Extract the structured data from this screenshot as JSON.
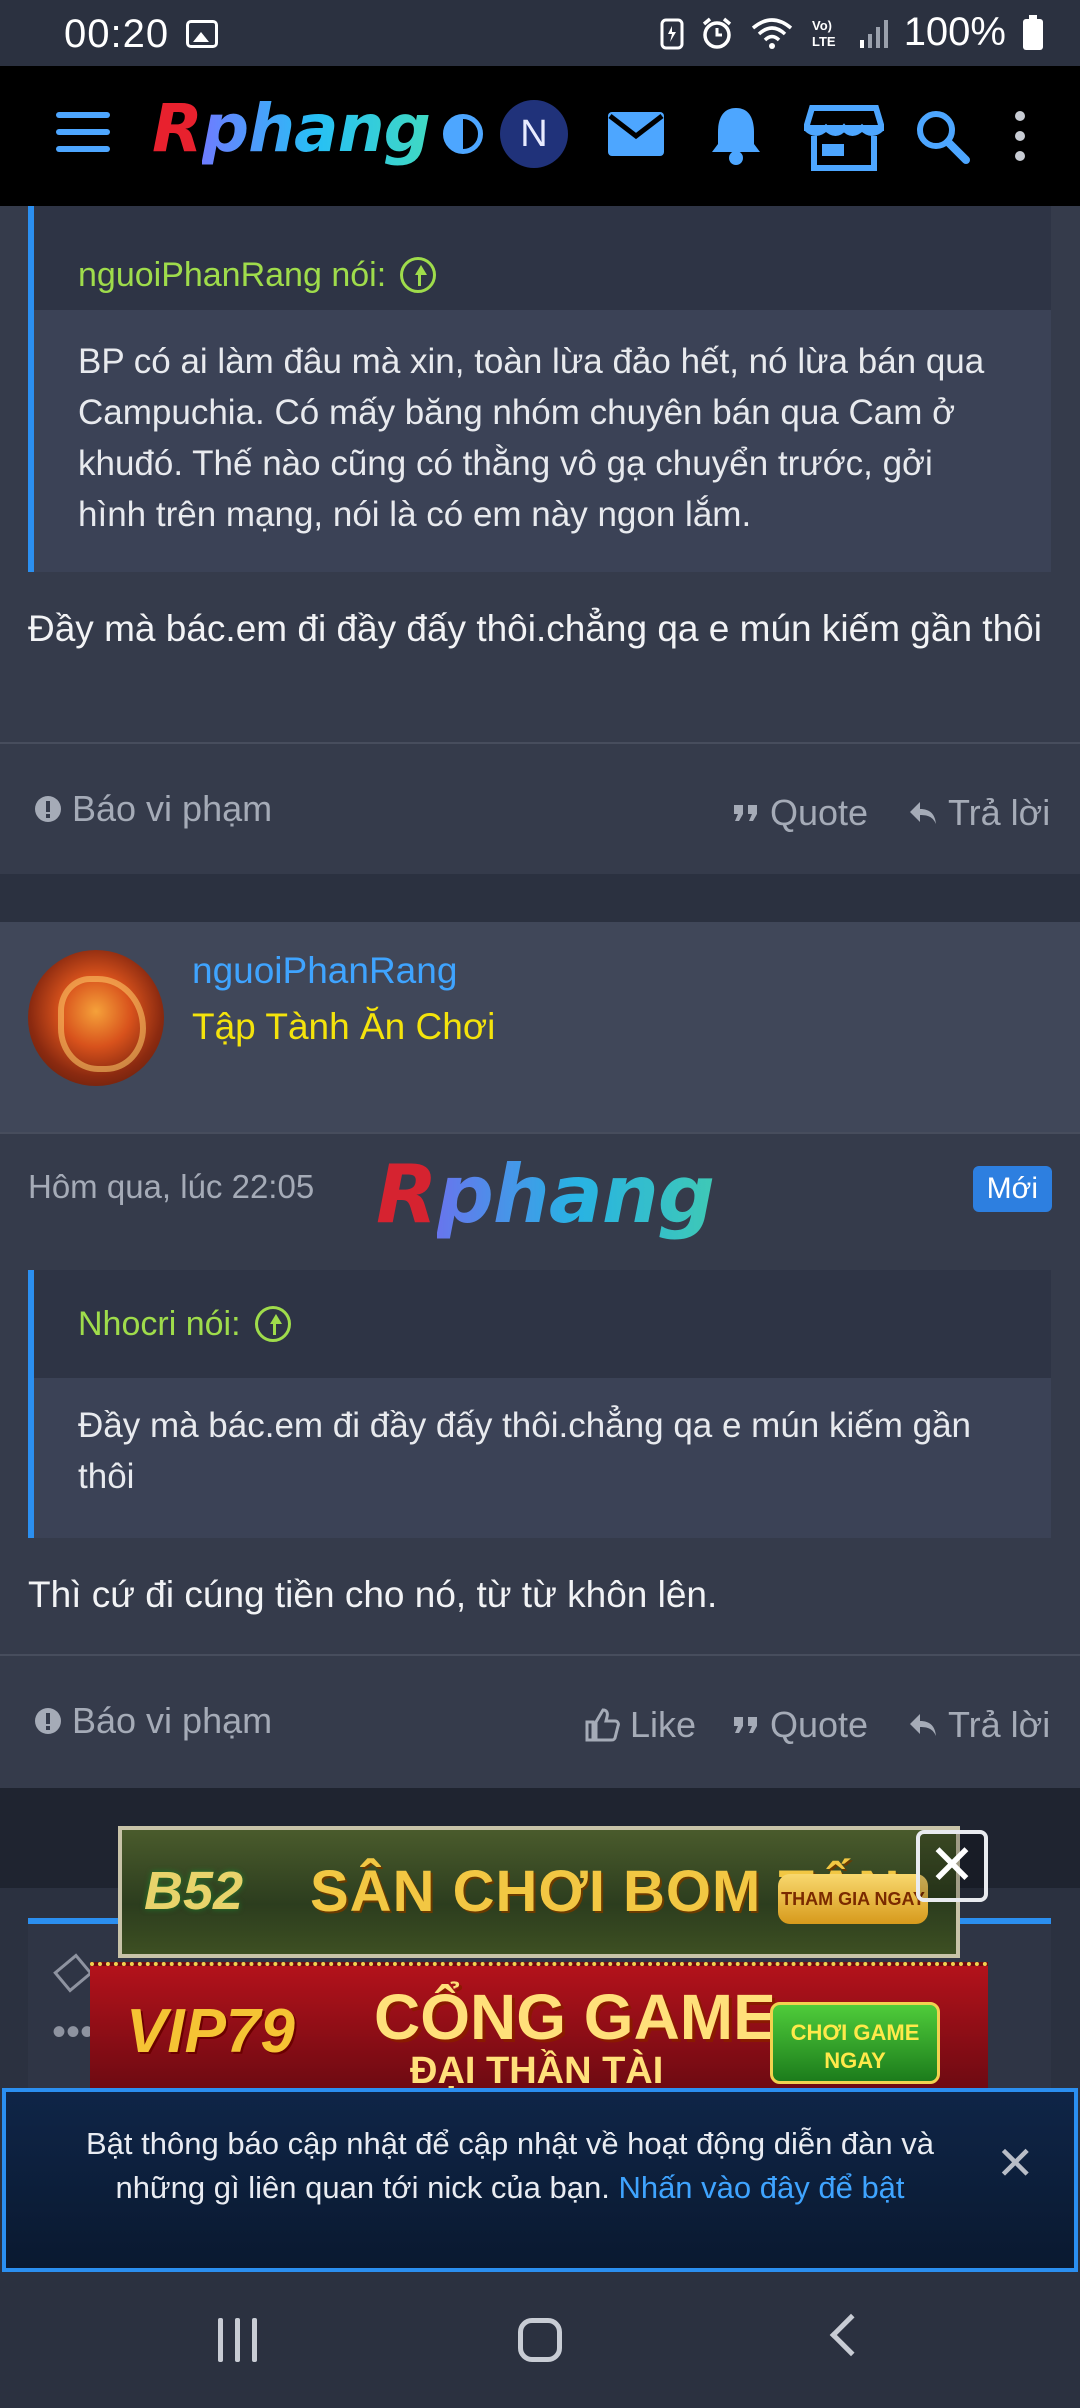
{
  "status_bar": {
    "time": "00:20",
    "battery": "100%"
  },
  "header": {
    "logo_first": "R",
    "logo_rest": "phang",
    "avatar_initial": "N"
  },
  "post1": {
    "quote_author": "nguoiPhanRang nói:",
    "quote_text": "BP có ai làm đâu mà xin, toàn lừa đảo hết, nó lừa bán qua Campuchia. Có mấy băng nhóm chuyên bán qua Cam ở khuđó. Thế nào cũng có thằng vô gạ chuyển trước, gởi hình trên mạng, nói là có em này ngon lắm.",
    "text": "Đầy mà bác.em đi đầy đấy thôi.chẳng qa e mún kiếm gần thôi",
    "report": "Báo vi phạm",
    "quote": "Quote",
    "reply": "Trả lời"
  },
  "post2": {
    "username": "nguoiPhanRang",
    "user_title": "Tập Tành Ăn Chơi",
    "date": "Hôm qua, lúc 22:05",
    "badge": "Mới",
    "quote_author": "Nhocri nói:",
    "quote_text": "Đầy mà bác.em đi đầy đấy thôi.chẳng qa e mún kiếm gần thôi",
    "text": "Thì cứ đi cúng tiền cho nó, từ từ khôn lên.",
    "report": "Báo vi phạm",
    "like": "Like",
    "quote": "Quote",
    "reply": "Trả lời"
  },
  "ads": {
    "ad1_brand": "B52",
    "ad1_title": "SÂN CHƠI BOM TẤN",
    "ad1_cta": "THAM GIA NGAY",
    "ad2_brand": "VIP79",
    "ad2_title": "CỔNG GAME",
    "ad2_subtitle": "ĐẠI THẦN TÀI",
    "ad2_cta": "CHƠI GAME NGAY",
    "close": "✕"
  },
  "notification": {
    "message": "Bật thông báo cập nhật để cập nhật về hoạt động diễn đàn và những gì liên quan tới nick của bạn.",
    "link": "Nhấn vào đây để bật",
    "close": "✕"
  },
  "colors": {
    "accent": "#2b8ff0",
    "quote_author": "#9fdc4b",
    "username": "#3fa4ff",
    "user_title": "#f4e30c",
    "badge": "#2d7fe0"
  }
}
